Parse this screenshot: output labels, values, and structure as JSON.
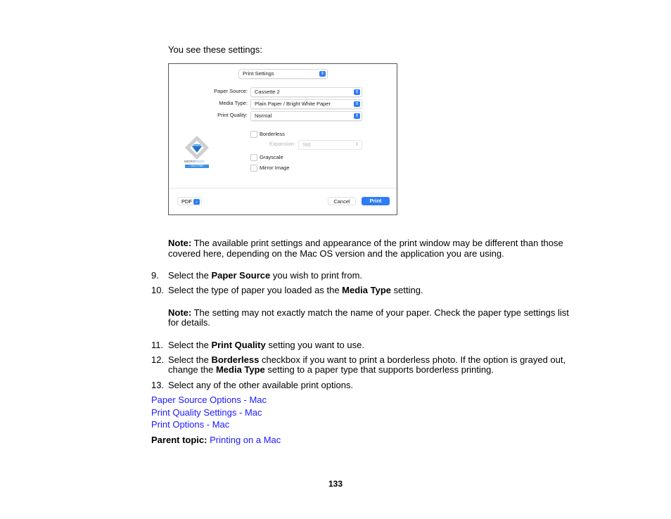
{
  "intro": "You see these settings:",
  "dialog": {
    "preset_select": "Print Settings",
    "fields": [
      {
        "label": "Paper Source:",
        "value": "Cassette 2"
      },
      {
        "label": "Media Type:",
        "value": "Plain Paper / Bright White Paper"
      },
      {
        "label": "Print Quality:",
        "value": "Normal"
      }
    ],
    "borderless_label": "Borderless",
    "expansion_label": "Expansion:",
    "expansion_value": "Std",
    "grayscale_label": "Grayscale",
    "mirror_label": "Mirror Image",
    "logo_line1_a": "MICRO",
    "logo_line1_b": "PIEZO",
    "logo_line2": "HEAT-FREE",
    "pdf_label": "PDF",
    "cancel_label": "Cancel",
    "print_label": "Print"
  },
  "note1": {
    "label": "Note:",
    "line1": " The available print settings and appearance of the print window may be different than those",
    "line2": "covered here, depending on the Mac OS version and the application you are using."
  },
  "steps": [
    {
      "num": "9.",
      "pre": "Select the ",
      "bold": "Paper Source",
      "post": " you wish to print from."
    },
    {
      "num": "10.",
      "pre": "Select the type of paper you loaded as the ",
      "bold": "Media Type",
      "post": " setting."
    },
    {
      "num": "11.",
      "pre": "Select the ",
      "bold": "Print Quality",
      "post": " setting you want to use."
    },
    {
      "num": "12.",
      "pre": "Select the ",
      "bold": "Borderless",
      "post": " checkbox if you want to print a borderless photo. If the option is grayed out,",
      "line2_pre": "change the ",
      "line2_bold": "Media Type",
      "line2_post": " setting to a paper type that supports borderless printing."
    },
    {
      "num": "13.",
      "pre": "Select any of the other available print options.",
      "bold": "",
      "post": ""
    }
  ],
  "note2": {
    "label": "Note:",
    "line1": " The setting may not exactly match the name of your paper. Check the paper type settings list",
    "line2": "for details."
  },
  "links": [
    "Paper Source Options - Mac",
    "Print Quality Settings - Mac",
    "Print Options - Mac"
  ],
  "parent": {
    "label": "Parent topic:",
    "link": "Printing on a Mac"
  },
  "page_number": "133"
}
